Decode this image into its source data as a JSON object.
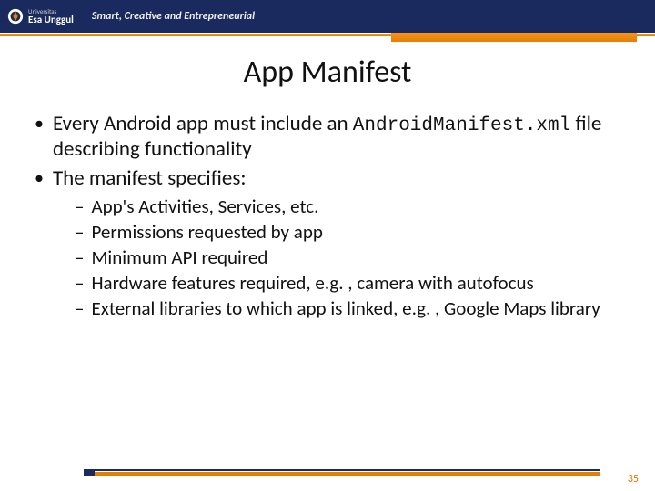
{
  "header": {
    "logo_top": "Universitas",
    "logo_name": "Esa Unggul",
    "tagline": "Smart, Creative and Entrepreneurial"
  },
  "title": "App Manifest",
  "bullets": [
    {
      "pre": "Every Android app must include an ",
      "code": "AndroidManifest.xml",
      "post": " file describing functionality"
    },
    {
      "pre": "The manifest specifies:",
      "code": "",
      "post": ""
    }
  ],
  "sub": [
    "App's Activities, Services, etc.",
    "Permissions requested by app",
    "Minimum API required",
    "Hardware features required, e.g. , camera with autofocus",
    "External libraries to which app is linked, e.g. , Google Maps library"
  ],
  "slide_number": "35"
}
